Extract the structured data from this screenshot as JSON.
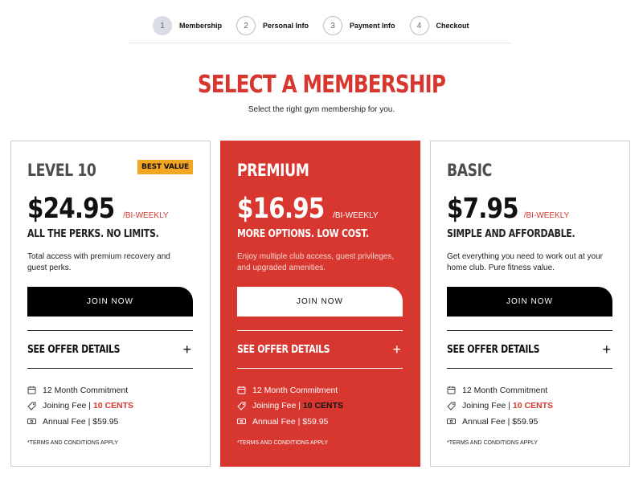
{
  "stepper": {
    "steps": [
      {
        "num": "1",
        "label": "Membership"
      },
      {
        "num": "2",
        "label": "Personal Info"
      },
      {
        "num": "3",
        "label": "Payment Info"
      },
      {
        "num": "4",
        "label": "Checkout"
      }
    ],
    "active_step": 1
  },
  "heading": {
    "title": "SELECT A MEMBERSHIP",
    "subtitle": "Select the right gym membership for you."
  },
  "plans": [
    {
      "name": "LEVEL 10",
      "badge": "BEST VALUE",
      "price": "$24.95",
      "period": "/BI-WEEKLY",
      "tagline": "ALL THE PERKS. NO LIMITS.",
      "description": "Total access with premium recovery and guest perks.",
      "button": "JOIN NOW",
      "offer_label": "SEE OFFER DETAILS",
      "features": {
        "commitment": "12 Month Commitment",
        "joining_fee_label": "Joining Fee | ",
        "joining_fee_value": "10 CENTS",
        "annual_fee": "Annual Fee | $59.95"
      },
      "terms": "*TERMS AND CONDITIONS APPLY"
    },
    {
      "name": "PREMIUM",
      "price": "$16.95",
      "period": "/BI-WEEKLY",
      "tagline": "MORE OPTIONS. LOW COST.",
      "description": "Enjoy multiple club access, guest privileges, and upgraded amenities.",
      "button": "JOIN NOW",
      "offer_label": "SEE OFFER DETAILS",
      "features": {
        "commitment": "12 Month Commitment",
        "joining_fee_label": "Joining Fee | ",
        "joining_fee_value": "10 CENTS",
        "annual_fee": "Annual Fee | $59.95"
      },
      "terms": "*TERMS AND CONDITIONS APPLY"
    },
    {
      "name": "BASIC",
      "price": "$7.95",
      "period": "/BI-WEEKLY",
      "tagline": "SIMPLE AND AFFORDABLE.",
      "description": "Get everything you need to work out at your home club. Pure fitness value.",
      "button": "JOIN NOW",
      "offer_label": "SEE OFFER DETAILS",
      "features": {
        "commitment": "12 Month Commitment",
        "joining_fee_label": "Joining Fee | ",
        "joining_fee_value": "10 CENTS",
        "annual_fee": "Annual Fee | $59.95"
      },
      "terms": "*TERMS AND CONDITIONS APPLY"
    }
  ],
  "colors": {
    "accent": "#d7372f",
    "badge": "#f5a524",
    "button_dark": "#000000"
  }
}
